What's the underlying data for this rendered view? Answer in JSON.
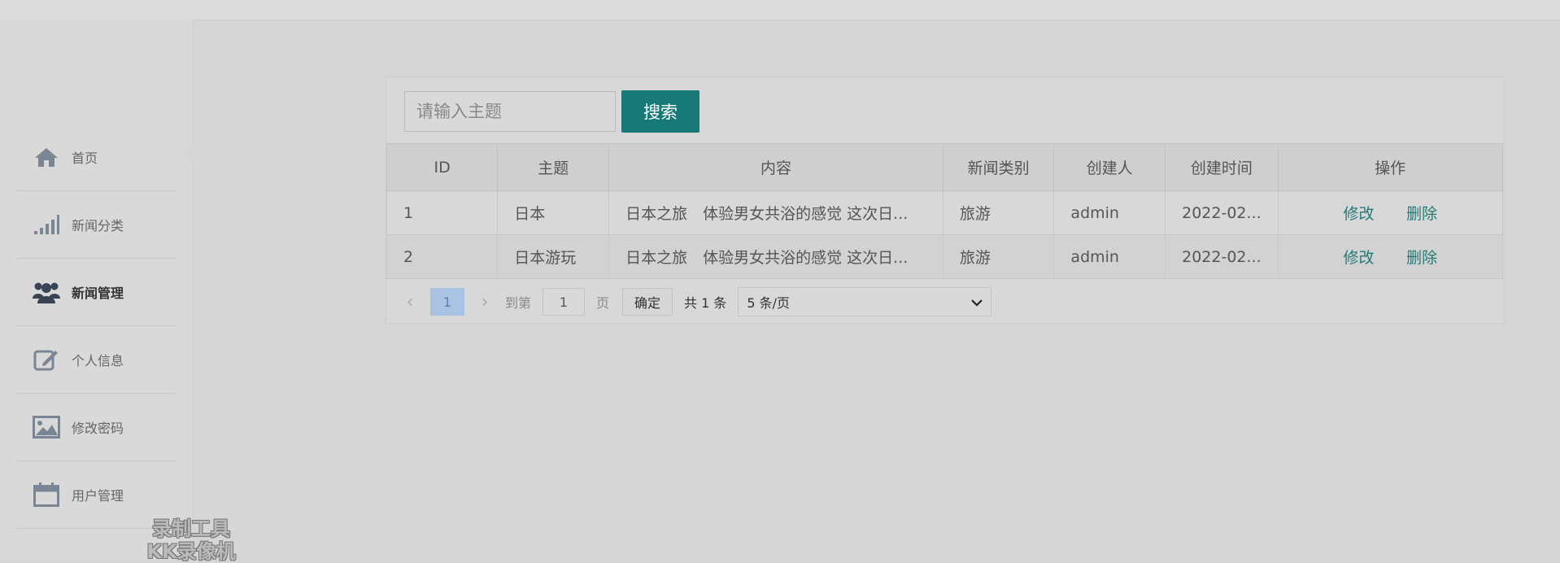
{
  "sidebar": {
    "items": [
      {
        "label": "首页",
        "icon": "home-icon"
      },
      {
        "label": "新闻分类",
        "icon": "signal-bars-icon"
      },
      {
        "label": "新闻管理",
        "icon": "users-icon",
        "active": true
      },
      {
        "label": "个人信息",
        "icon": "edit-icon"
      },
      {
        "label": "修改密码",
        "icon": "image-icon"
      },
      {
        "label": "用户管理",
        "icon": "calendar-icon"
      }
    ]
  },
  "search": {
    "placeholder": "请输入主题",
    "button_label": "搜索"
  },
  "table": {
    "headers": [
      "ID",
      "主题",
      "内容",
      "新闻类别",
      "创建人",
      "创建时间",
      "操作"
    ],
    "rows": [
      {
        "id": "1",
        "title": "日本",
        "content": "日本之旅　体验男女共浴的感觉 这次日...",
        "category": "旅游",
        "creator": "admin",
        "created": "2022-02...",
        "edit": "修改",
        "delete": "删除"
      },
      {
        "id": "2",
        "title": "日本游玩",
        "content": "日本之旅　体验男女共浴的感觉 这次日...",
        "category": "旅游",
        "creator": "admin",
        "created": "2022-02...",
        "edit": "修改",
        "delete": "删除"
      }
    ]
  },
  "pagination": {
    "prev": "‹",
    "current_page": "1",
    "next": "›",
    "goto_label": "到第",
    "goto_value": "1",
    "page_suffix": "页",
    "confirm_label": "确定",
    "total": "共 1 条",
    "page_size": "5 条/页"
  },
  "watermark": {
    "line1": "录制工具",
    "line2": "KK录像机"
  },
  "colors": {
    "accent": "#177a78",
    "link": "#237a77",
    "page_active": "#a9c3e2"
  }
}
